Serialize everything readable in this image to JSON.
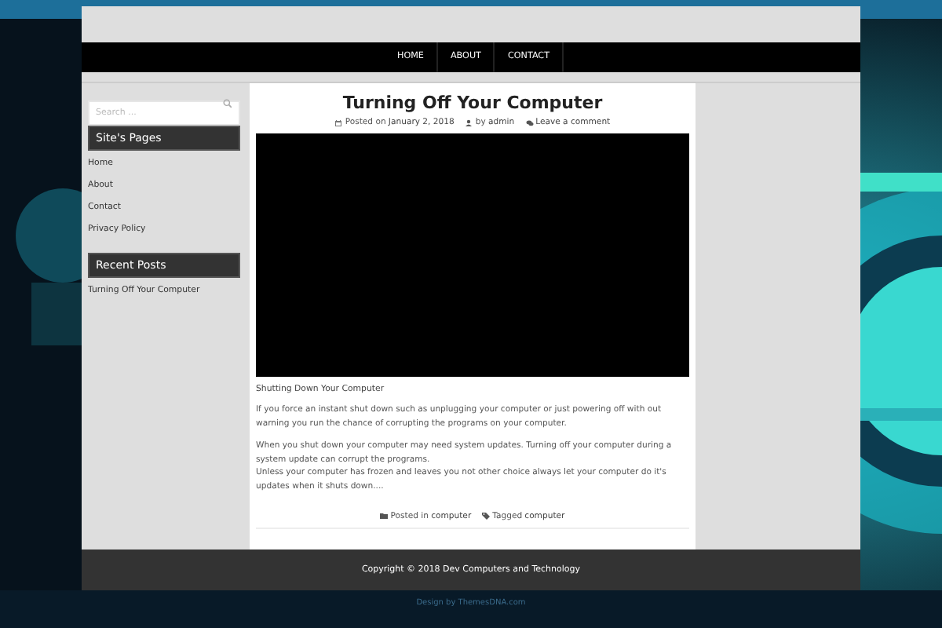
{
  "nav": [
    {
      "label": "HOME"
    },
    {
      "label": "ABOUT"
    },
    {
      "label": "CONTACT"
    }
  ],
  "search": {
    "placeholder": "Search ..."
  },
  "widgets": [
    {
      "title": "Site's Pages",
      "links": [
        "Home",
        "About",
        "Contact",
        "Privacy Policy"
      ]
    },
    {
      "title": "Recent Posts",
      "links": [
        "Turning Off Your Computer"
      ]
    }
  ],
  "post": {
    "title": "Turning Off Your Computer",
    "meta": [
      {
        "kind": "calendar",
        "text": "Posted on ",
        "link": "January 2, 2018"
      },
      {
        "kind": "user",
        "text": "by ",
        "link": "admin"
      },
      {
        "kind": "comments",
        "link": "Leave a comment"
      }
    ],
    "video": {
      "kind": "video"
    },
    "caption": "Shutting Down Your Computer",
    "paragraphs": [
      [
        "If you force an instant shut down such as unplugging your computer or just powering off with out warning you run the chance of corrupting the programs on your computer."
      ],
      [
        "When you shut down your computer may need system updates. Turning off your computer during a system update can corrupt the programs.",
        "Unless your computer has frozen and leaves you not other choice always let your computer do it's updates when it shuts down...."
      ]
    ],
    "footer_meta": [
      {
        "kind": "folder",
        "text": "Posted in ",
        "link": "computer"
      },
      {
        "kind": "tag",
        "text": "Tagged ",
        "link": "computer"
      }
    ]
  },
  "footer": {
    "copyright": "Copyright © 2018 Dev Computers and Technology",
    "credit": "Design by ThemesDNA.com"
  }
}
